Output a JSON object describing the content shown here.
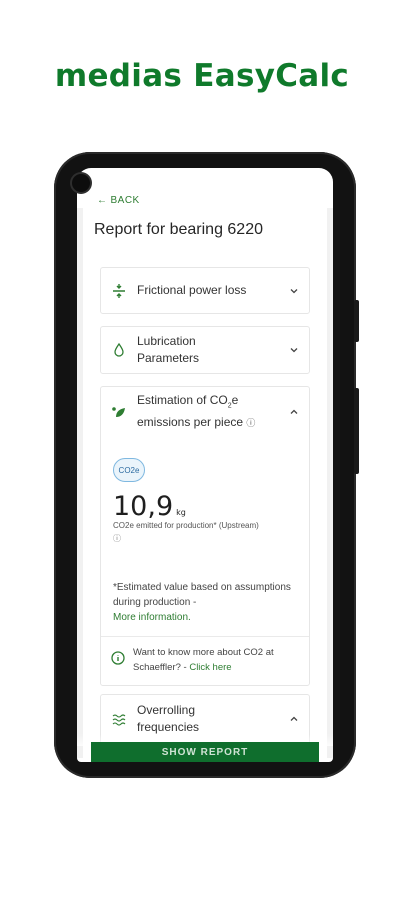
{
  "promo": {
    "title": "medias EasyCalc"
  },
  "header": {
    "back_label": "BACK",
    "title": "Report for bearing 6220"
  },
  "panels": [
    {
      "label": "Frictional power loss",
      "icon": "friction-icon",
      "expanded": false
    },
    {
      "label": "Lubrication Parameters",
      "icon": "drop-icon",
      "expanded": false
    },
    {
      "label_line1": "Estimation of CO",
      "label_sub": "2",
      "label_line1_end": "e",
      "label_line2": "emissions per piece",
      "icon": "leaf-icon",
      "expanded": true
    },
    {
      "label": "Overrolling frequencies",
      "icon": "wave-icon",
      "expanded": true
    }
  ],
  "co2": {
    "badge": "CO2e",
    "value": "10,9",
    "unit": "kg",
    "caption": "CO2e emitted for production* (Upstream)",
    "note": "*Estimated value based on assumptions during production -",
    "more_link": "More information.",
    "hint_text": "Want to know more about CO2 at Schaeffler? - ",
    "hint_link": "Click here"
  },
  "footer": {
    "button_label": "SHOW REPORT"
  },
  "colors": {
    "brand_green": "#0f7a2b",
    "accent_green": "#2e7d32",
    "badge_blue": "#7fb8e0"
  }
}
